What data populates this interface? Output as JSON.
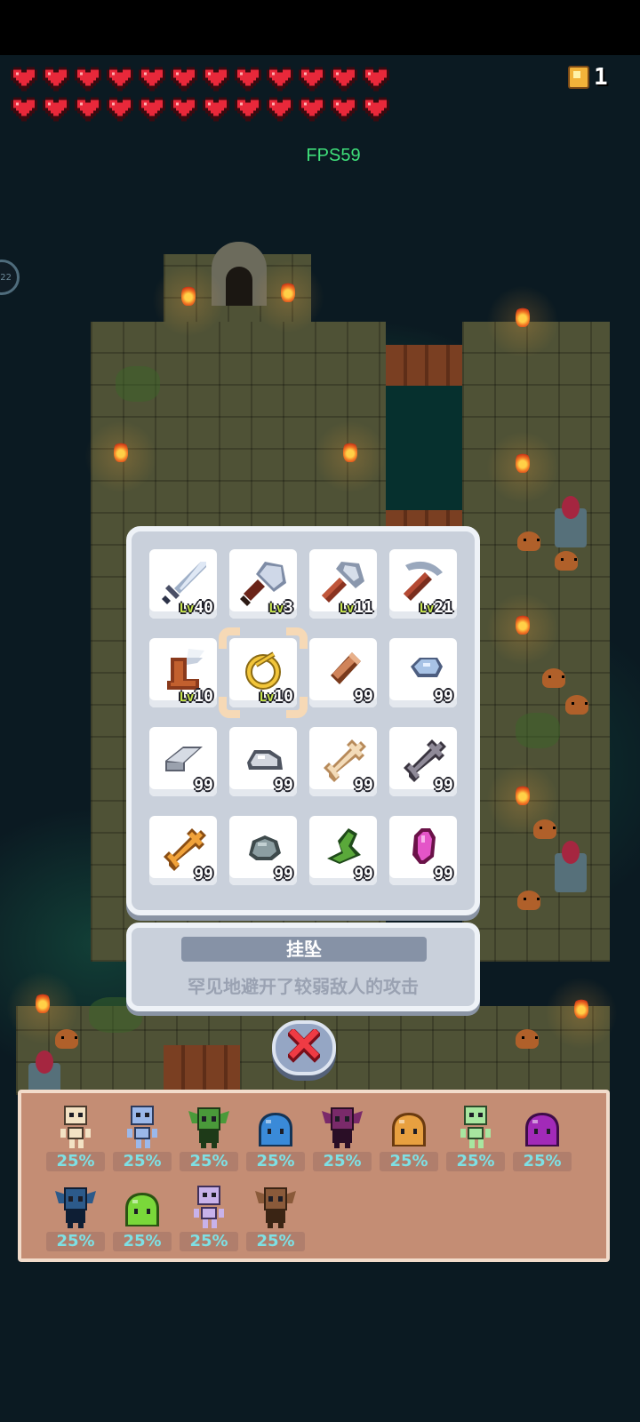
{
  "hud": {
    "hearts": 24,
    "heart_color": "#e8283a",
    "coin_icon": "gold-coin-icon",
    "coin_count": "1",
    "fps_text": "FPS59",
    "side_badge": "22"
  },
  "inventory": {
    "slots": [
      {
        "name": "sword",
        "icon": "sword-icon",
        "level_prefix": "Lv",
        "count": "40"
      },
      {
        "name": "shovel",
        "icon": "shovel-icon",
        "level_prefix": "Lv",
        "count": "3"
      },
      {
        "name": "axe",
        "icon": "axe-icon",
        "level_prefix": "Lv",
        "count": "11"
      },
      {
        "name": "pickaxe",
        "icon": "pickaxe-icon",
        "level_prefix": "Lv",
        "count": "21"
      },
      {
        "name": "winged-boot",
        "icon": "winged-boot-icon",
        "level_prefix": "Lv",
        "count": "10"
      },
      {
        "name": "pendant",
        "icon": "pendant-icon",
        "level_prefix": "Lv",
        "count": "10",
        "selected": true
      },
      {
        "name": "wood-log",
        "icon": "wood-log-icon",
        "level_prefix": "",
        "count": "99"
      },
      {
        "name": "blue-ore",
        "icon": "blue-ore-icon",
        "level_prefix": "",
        "count": "99"
      },
      {
        "name": "iron-ingot",
        "icon": "iron-ingot-icon",
        "level_prefix": "",
        "count": "99"
      },
      {
        "name": "stone",
        "icon": "stone-icon",
        "level_prefix": "",
        "count": "99"
      },
      {
        "name": "bone",
        "icon": "bone-icon",
        "level_prefix": "",
        "count": "99"
      },
      {
        "name": "dark-bone",
        "icon": "dark-bone-icon",
        "level_prefix": "",
        "count": "99"
      },
      {
        "name": "golden-bone",
        "icon": "golden-bone-icon",
        "level_prefix": "",
        "count": "99"
      },
      {
        "name": "gray-rock",
        "icon": "gray-rock-icon",
        "level_prefix": "",
        "count": "99"
      },
      {
        "name": "green-fang",
        "icon": "green-fang-icon",
        "level_prefix": "",
        "count": "99"
      },
      {
        "name": "magenta-gem",
        "icon": "magenta-gem-icon",
        "level_prefix": "",
        "count": "99"
      }
    ]
  },
  "description": {
    "title": "挂坠",
    "text": "罕见地避开了较弱敌人的攻击"
  },
  "close": {
    "icon": "close-x-icon"
  },
  "enemies": [
    {
      "name": "skeleton",
      "icon": "skeleton-icon",
      "chance": "25%"
    },
    {
      "name": "blue-skeleton",
      "icon": "blue-skeleton-icon",
      "chance": "25%"
    },
    {
      "name": "green-goblin",
      "icon": "green-goblin-icon",
      "chance": "25%"
    },
    {
      "name": "blue-slime",
      "icon": "blue-slime-icon",
      "chance": "25%"
    },
    {
      "name": "purple-goblin",
      "icon": "purple-goblin-icon",
      "chance": "25%"
    },
    {
      "name": "orange-slime",
      "icon": "orange-slime-icon",
      "chance": "25%"
    },
    {
      "name": "green-skeleton",
      "icon": "green-skeleton-icon",
      "chance": "25%"
    },
    {
      "name": "purple-slime",
      "icon": "purple-slime-icon",
      "chance": "25%"
    },
    {
      "name": "blue-goblin",
      "icon": "blue-goblin-icon",
      "chance": "25%"
    },
    {
      "name": "green-slime",
      "icon": "green-slime-icon",
      "chance": "25%"
    },
    {
      "name": "lavender-skeleton",
      "icon": "lavender-skeleton-icon",
      "chance": "25%"
    },
    {
      "name": "brown-goblin",
      "icon": "brown-goblin-icon",
      "chance": "25%"
    }
  ],
  "colors": {
    "panel_bg": "#c9d0db",
    "enemy_panel_bg": "#c48d74",
    "chance_text": "#7ee0e4",
    "fps_text": "#3fe07a"
  }
}
